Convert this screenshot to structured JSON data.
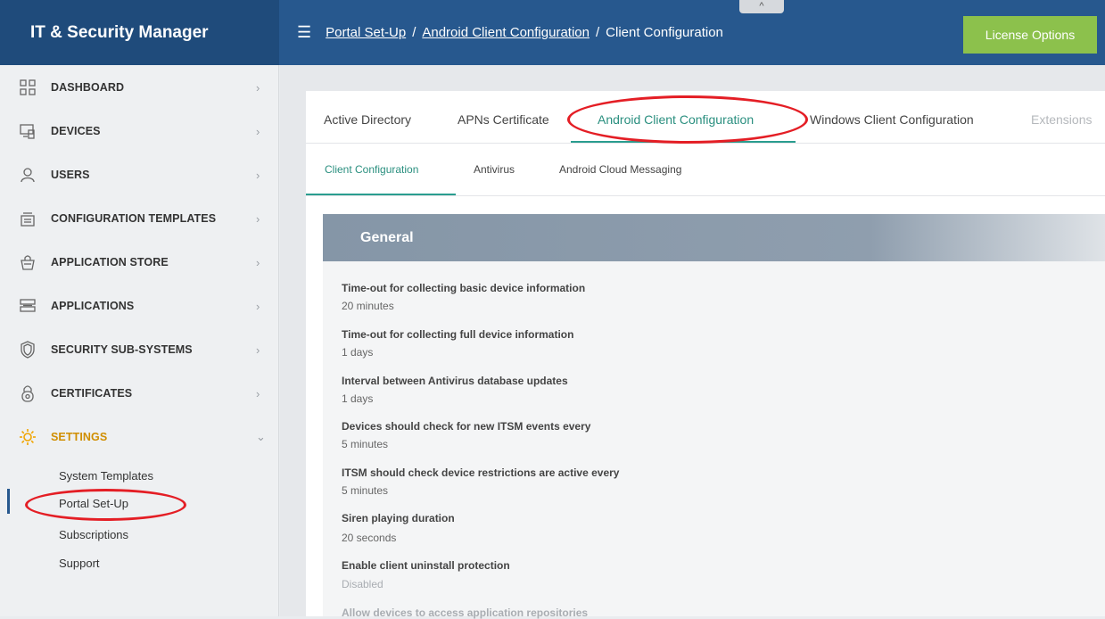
{
  "app_title": "IT & Security Manager",
  "breadcrumb": {
    "items": [
      "Portal Set-Up",
      "Android Client Configuration"
    ],
    "current": "Client Configuration",
    "separator": "/"
  },
  "collapse_label": "^",
  "license_button": "License Options",
  "sidebar": {
    "items": [
      {
        "label": "DASHBOARD",
        "icon": "dashboard-icon"
      },
      {
        "label": "DEVICES",
        "icon": "devices-icon"
      },
      {
        "label": "USERS",
        "icon": "user-icon"
      },
      {
        "label": "CONFIGURATION TEMPLATES",
        "icon": "templates-icon"
      },
      {
        "label": "APPLICATION STORE",
        "icon": "store-icon"
      },
      {
        "label": "APPLICATIONS",
        "icon": "applications-icon"
      },
      {
        "label": "SECURITY SUB-SYSTEMS",
        "icon": "shield-icon"
      },
      {
        "label": "CERTIFICATES",
        "icon": "certificate-icon"
      },
      {
        "label": "SETTINGS",
        "icon": "gear-icon"
      }
    ],
    "settings_children": [
      "System Templates",
      "Portal Set-Up",
      "Subscriptions",
      "Support"
    ]
  },
  "tabs": [
    "Active Directory",
    "APNs Certificate",
    "Android Client Configuration",
    "Windows Client Configuration",
    "Extensions"
  ],
  "active_tab": "Android Client Configuration",
  "subtabs": [
    "Client Configuration",
    "Antivirus",
    "Android Cloud Messaging"
  ],
  "active_subtab": "Client Configuration",
  "section_title": "General",
  "settings": [
    {
      "label": "Time-out for collecting basic device information",
      "value": "20 minutes"
    },
    {
      "label": "Time-out for collecting full device information",
      "value": "1 days"
    },
    {
      "label": "Interval between Antivirus database updates",
      "value": "1 days"
    },
    {
      "label": "Devices should check for new ITSM events every",
      "value": "5 minutes"
    },
    {
      "label": "ITSM should check device restrictions are active every",
      "value": "5 minutes"
    },
    {
      "label": "Siren playing duration",
      "value": "20 seconds"
    },
    {
      "label": "Enable client uninstall protection",
      "value": "Disabled"
    },
    {
      "label": "Allow devices to access application repositories",
      "value": ""
    }
  ],
  "colors": {
    "brand_bg": "#1f4b7b",
    "topbar_bg": "#27588e",
    "license_btn": "#8cc14c",
    "accent_underline": "#2a9d8f",
    "annotation_red": "#e41e25",
    "settings_icon": "#f0a500"
  }
}
